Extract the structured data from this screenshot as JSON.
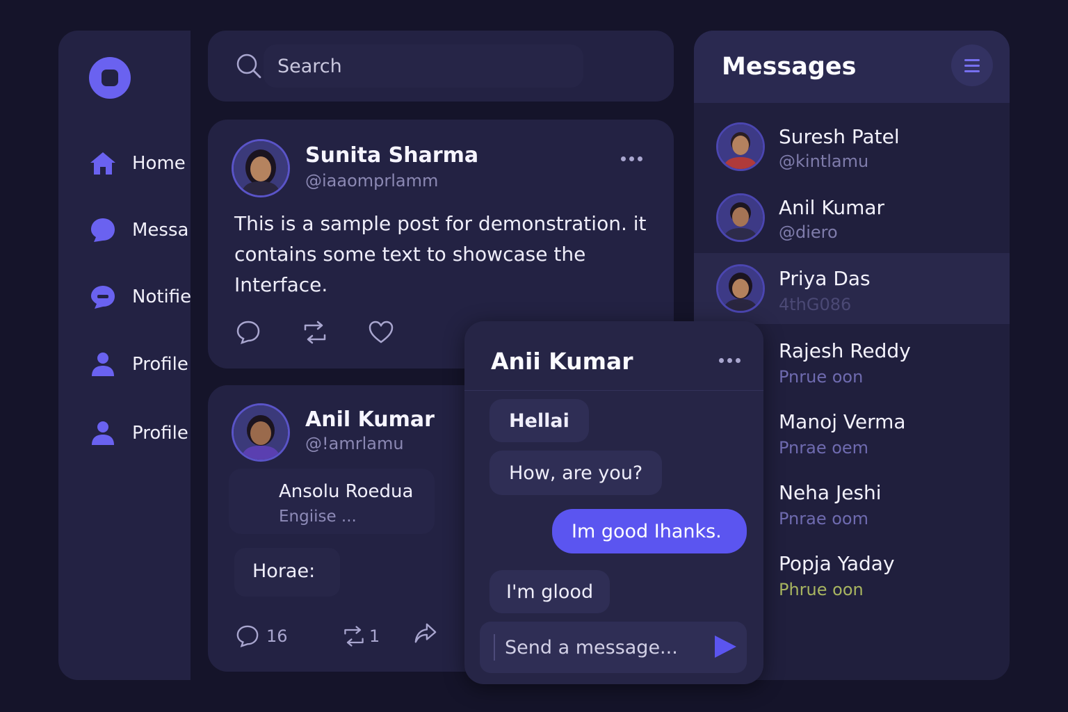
{
  "sidebar": {
    "logo_icon": "app-logo-icon",
    "items": [
      {
        "label": "Home",
        "icon": "home-icon"
      },
      {
        "label": "Messa",
        "icon": "chat-bubble-icon"
      },
      {
        "label": "Notifie",
        "icon": "notification-bubble-icon"
      },
      {
        "label": "Profile",
        "icon": "person-icon"
      },
      {
        "label": "Profile",
        "icon": "person-icon"
      }
    ]
  },
  "search": {
    "placeholder": "Search",
    "icon": "search-icon"
  },
  "post1": {
    "author": "Sunita Sharma",
    "handle": "@iaaomprlamm",
    "body": "This is a sample post for demonstration. it contains some text to showcase the Interface.",
    "actions": [
      "comment-icon",
      "repost-icon",
      "heart-icon"
    ]
  },
  "post2": {
    "author": "Anil Kumar",
    "handle": "@!amrlamu",
    "card_title": "Ansolu Roedua",
    "card_subtitle": "Engiise ...",
    "chip": "Horae:",
    "comments": "16",
    "reposts": "1"
  },
  "messages": {
    "title": "Messages",
    "contacts": [
      {
        "name": "Suresh Patel",
        "handle": "@kintlamu"
      },
      {
        "name": "Anil Kumar",
        "handle": "@diero"
      },
      {
        "name": "Priya Das",
        "handle": "4thG086"
      },
      {
        "name": "Rajesh Reddy",
        "handle": "Pnrue oon"
      },
      {
        "name": "Manoj Verma",
        "handle": "Pnrae oem"
      },
      {
        "name": "Neha Jeshi",
        "handle": "Pnrae oom"
      },
      {
        "name": "Popja Yaday",
        "handle": "Phrue oon"
      }
    ]
  },
  "chat": {
    "title": "Anii Kumar",
    "messages": [
      {
        "text": "Hellai",
        "from": "them"
      },
      {
        "text": "How, are you?",
        "from": "them"
      },
      {
        "text": "Im good  Ihanks.",
        "from": "me"
      },
      {
        "text": "I'm glood",
        "from": "them"
      }
    ],
    "composer_placeholder": "Send a message...",
    "send_icon": "send-icon"
  },
  "colors": {
    "accent": "#6a62f0",
    "background": "#15142a",
    "panel": "#232243",
    "bubble_me": "#5b55f0"
  }
}
